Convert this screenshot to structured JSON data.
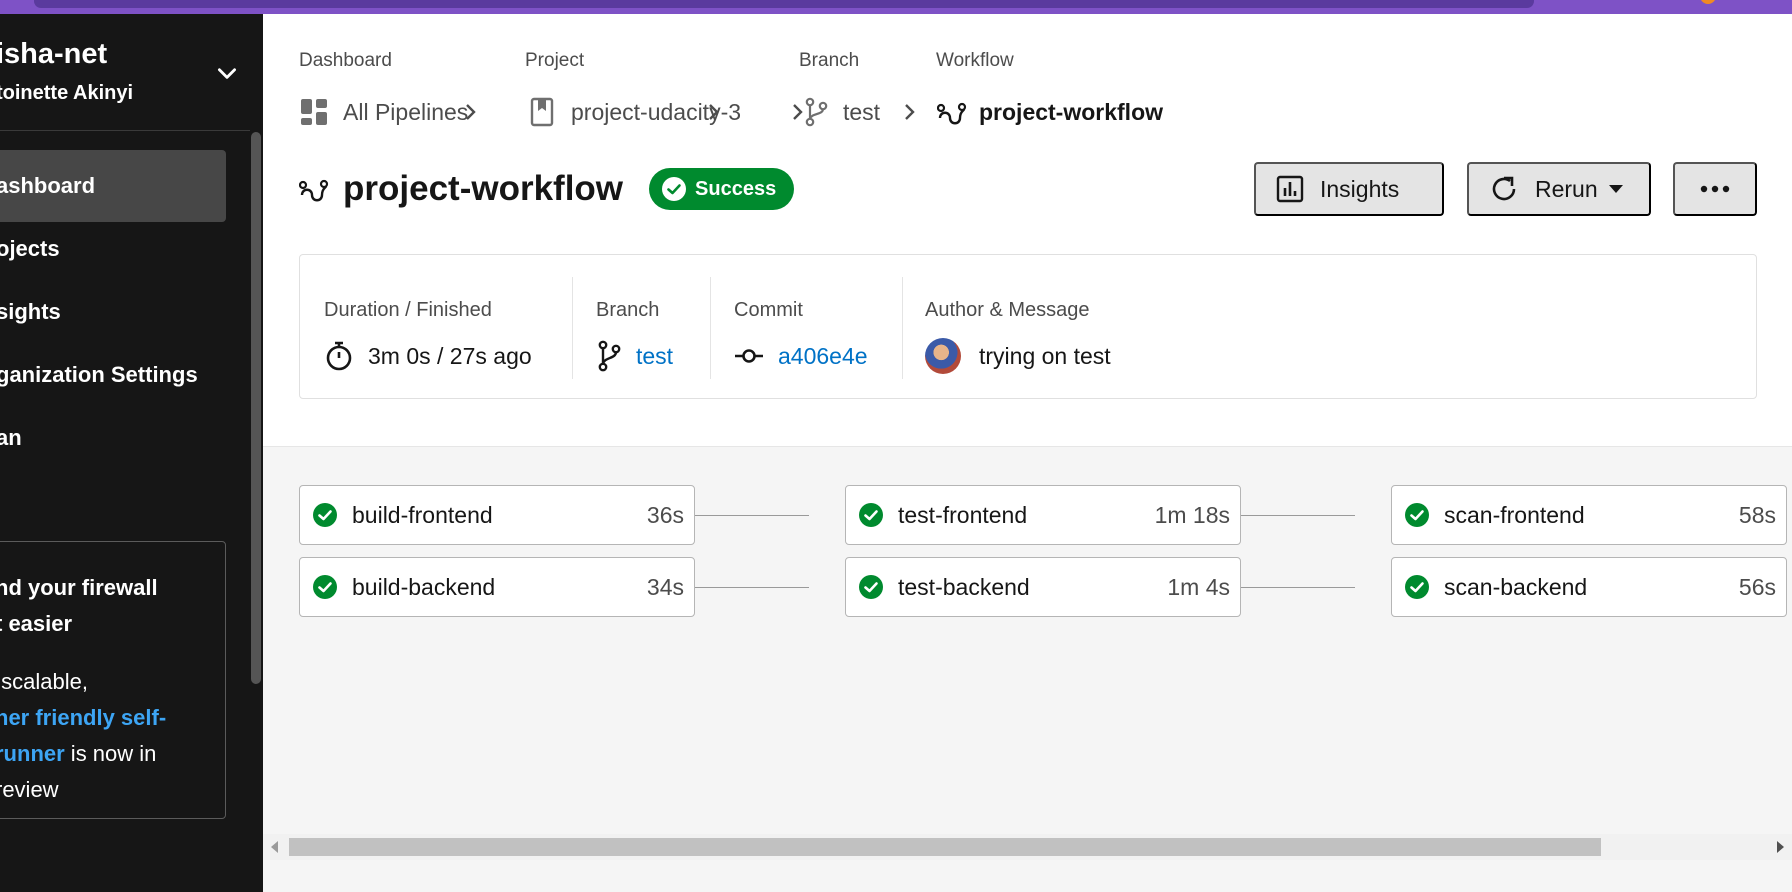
{
  "sidebar": {
    "org_name": "isha-net",
    "user_name": "toinette Akinyi",
    "nav_items": [
      {
        "label": "ashboard",
        "active": true
      },
      {
        "label": "ojects",
        "active": false
      },
      {
        "label": "sights",
        "active": false
      },
      {
        "label": "ganization Settings",
        "active": false
      },
      {
        "label": "an",
        "active": false
      }
    ],
    "promo": {
      "title": "nd your firewall\nt easier",
      "body_1": " scalable,",
      "link_1": "ner friendly self-",
      "link_2": "runner",
      "body_2": " is now in",
      "body_3": "review"
    }
  },
  "breadcrumb": {
    "dashboard_label": "Dashboard",
    "dashboard_value": "All Pipelines",
    "project_label": "Project",
    "project_value": "project-udacity-3",
    "branch_label": "Branch",
    "branch_value": "test",
    "workflow_label": "Workflow",
    "workflow_value": "project-workflow"
  },
  "header": {
    "title": "project-workflow",
    "status": "Success",
    "insights_label": "Insights",
    "rerun_label": "Rerun"
  },
  "info": {
    "duration_label": "Duration / Finished",
    "duration_value": "3m 0s / 27s ago",
    "branch_label": "Branch",
    "branch_value": "test",
    "commit_label": "Commit",
    "commit_value": "a406e4e",
    "author_label": "Author & Message",
    "message_value": "trying on test"
  },
  "jobs": [
    {
      "name": "build-frontend",
      "duration": "36s",
      "status": "success"
    },
    {
      "name": "build-backend",
      "duration": "34s",
      "status": "success"
    },
    {
      "name": "test-frontend",
      "duration": "1m 18s",
      "status": "success"
    },
    {
      "name": "test-backend",
      "duration": "1m 4s",
      "status": "success"
    },
    {
      "name": "scan-frontend",
      "duration": "58s",
      "status": "success"
    },
    {
      "name": "scan-backend",
      "duration": "56s",
      "status": "success"
    }
  ],
  "colors": {
    "success": "#008a2e",
    "link": "#0072c6",
    "sidebar_bg": "#161616",
    "browser_bar": "#7e52c6"
  },
  "icons": [
    "dashboard-grid-icon",
    "bookmark-icon",
    "branch-icon",
    "workflow-icon",
    "stopwatch-icon",
    "commit-icon",
    "chart-icon",
    "refresh-icon",
    "caret-down-icon",
    "more-icon",
    "check-circle-icon",
    "chevron-right-icon"
  ]
}
